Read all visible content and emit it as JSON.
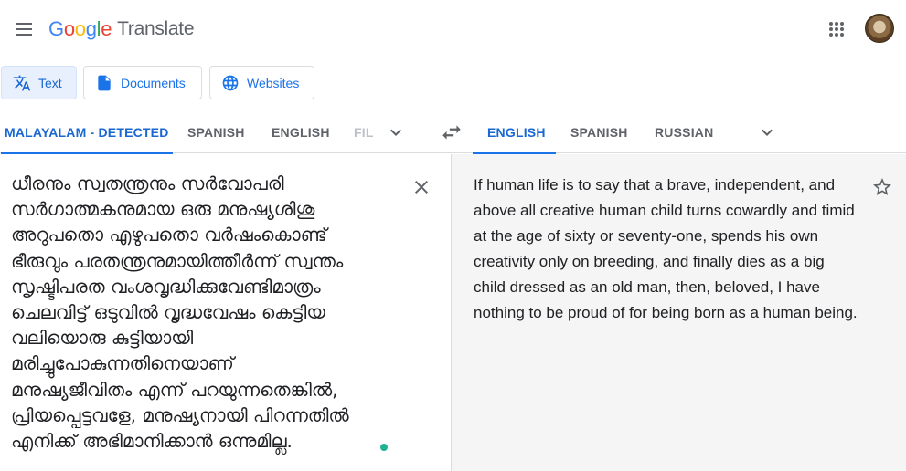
{
  "header": {
    "logo_letters": [
      "G",
      "o",
      "o",
      "g",
      "l",
      "e"
    ],
    "product": "Translate"
  },
  "modes": [
    {
      "label": "Text",
      "icon": "translate-icon",
      "active": true
    },
    {
      "label": "Documents",
      "icon": "document-icon",
      "active": false
    },
    {
      "label": "Websites",
      "icon": "globe-icon",
      "active": false
    }
  ],
  "source_langs": [
    "MALAYALAM - DETECTED",
    "SPANISH",
    "ENGLISH",
    "FIL"
  ],
  "target_langs": [
    "ENGLISH",
    "SPANISH",
    "RUSSIAN"
  ],
  "source": {
    "text": "ധീരനും സ്വതന്ത്രനും സർവോപരി\nസർഗാത്മകനുമായ ഒരു മനുഷ്യശിശു\nഅറുപതൊ എഴുപതൊ വർഷംകൊണ്ട്\nഭീരുവും പരതന്ത്രനുമായിത്തീർന്ന് സ്വന്തം\nസൃഷ്ടിപരത വംശവൃദ്ധിക്കുവേണ്ടിമാത്രം\nചെലവിട്ട് ഒടുവിൽ വൃദ്ധവേഷം കെട്ടിയ\nവലിയൊരു കുട്ടിയായി\nമരിച്ചുപോകുന്നതിനെയാണ്\nമനുഷ്യജീവിതം എന്ന് പറയുന്നതെങ്കിൽ,\nപ്രിയപ്പെട്ടവളേ, മനുഷ്യനായി പിറന്നതിൽ\nഎനിക്ക് അഭിമാനിക്കാൻ ഒന്നുമില്ല."
  },
  "target": {
    "text": "If human life is to say that a brave, independent, and above all creative human child turns cowardly and timid at the age of sixty or seventy-one, spends his own creativity only on breeding, and finally dies as a big child dressed as an old man, then, beloved, I have nothing to be proud of for being born as a human being."
  },
  "colors": {
    "accent": "#1a73e8",
    "active_bg": "#e8f0fe",
    "status_dot": "#1db390"
  }
}
